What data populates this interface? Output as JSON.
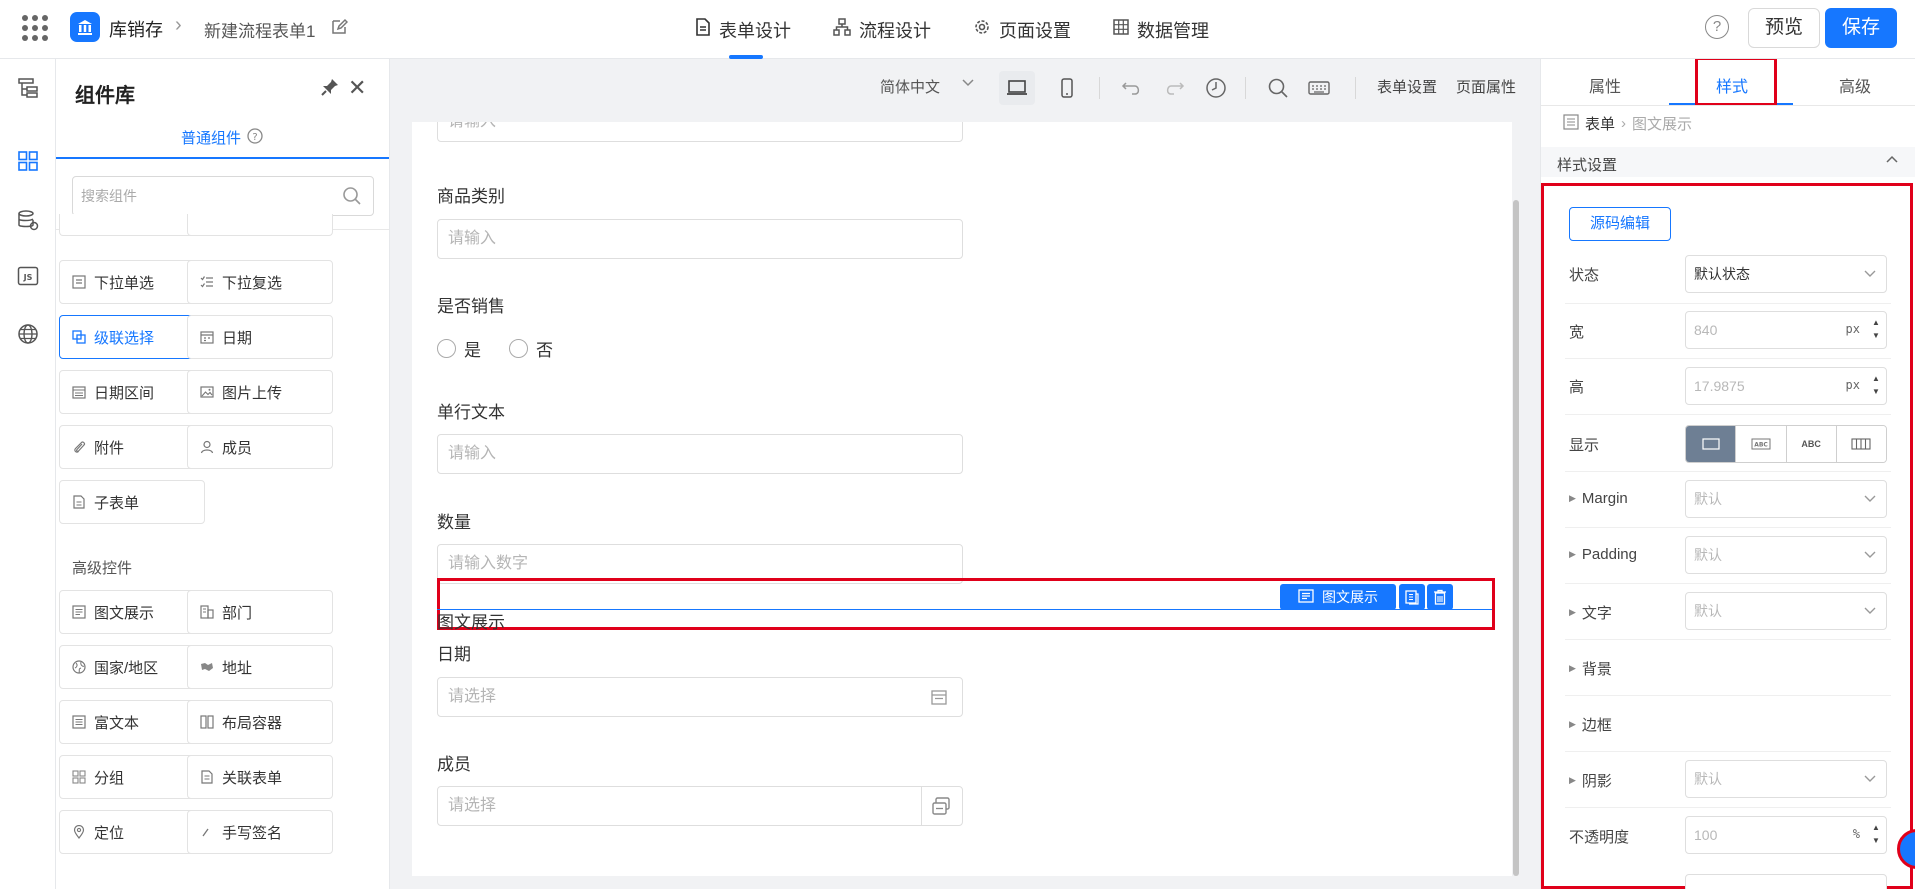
{
  "topbar": {
    "app_name": "库销存",
    "form_name": "新建流程表单1",
    "tabs": [
      {
        "label": "表单设计",
        "icon": "file-text-icon",
        "active": true
      },
      {
        "label": "流程设计",
        "icon": "flow-chart-icon",
        "active": false
      },
      {
        "label": "页面设置",
        "icon": "gear-icon",
        "active": false
      },
      {
        "label": "数据管理",
        "icon": "grid-table-icon",
        "active": false
      }
    ],
    "help": "?",
    "preview_label": "预览",
    "save_label": "保存"
  },
  "library": {
    "title": "组件库",
    "tab_label": "普通组件",
    "search_placeholder": "搜索组件",
    "basic": [
      {
        "label": "下拉单选",
        "icon": "dropdown-single-icon"
      },
      {
        "label": "下拉复选",
        "icon": "dropdown-multi-icon"
      },
      {
        "label": "级联选择",
        "icon": "cascade-icon",
        "active": true
      },
      {
        "label": "日期",
        "icon": "calendar-icon"
      },
      {
        "label": "日期区间",
        "icon": "calendar-range-icon"
      },
      {
        "label": "图片上传",
        "icon": "image-icon"
      },
      {
        "label": "附件",
        "icon": "paperclip-icon"
      },
      {
        "label": "成员",
        "icon": "user-icon"
      },
      {
        "label": "子表单",
        "icon": "subform-icon"
      }
    ],
    "advanced_title": "高级控件",
    "advanced": [
      {
        "label": "图文展示",
        "icon": "text-image-icon"
      },
      {
        "label": "部门",
        "icon": "department-icon"
      },
      {
        "label": "国家/地区",
        "icon": "globe-icon"
      },
      {
        "label": "地址",
        "icon": "map-icon"
      },
      {
        "label": "富文本",
        "icon": "rich-text-icon"
      },
      {
        "label": "布局容器",
        "icon": "layout-icon"
      },
      {
        "label": "分组",
        "icon": "group-icon"
      },
      {
        "label": "关联表单",
        "icon": "linked-form-icon"
      },
      {
        "label": "定位",
        "icon": "location-icon"
      },
      {
        "label": "手写签名",
        "icon": "signature-icon"
      }
    ]
  },
  "toolbar": {
    "language": "简体中文",
    "form_settings": "表单设置",
    "page_props": "页面属性"
  },
  "form": {
    "top_placeholder": "请输入",
    "fields": {
      "category": {
        "label": "商品类别",
        "placeholder": "请输入"
      },
      "for_sale": {
        "label": "是否销售",
        "options": [
          "是",
          "否"
        ]
      },
      "single_text": {
        "label": "单行文本",
        "placeholder": "请输入"
      },
      "quantity": {
        "label": "数量",
        "placeholder": "请输入数字"
      },
      "date": {
        "label": "日期",
        "placeholder": "请选择"
      },
      "member": {
        "label": "成员",
        "placeholder": "请选择"
      }
    },
    "selected": {
      "tag": "图文展示",
      "text": "图文展示"
    }
  },
  "panel": {
    "tabs": [
      "属性",
      "样式",
      "高级"
    ],
    "active_tab": "样式",
    "crumb_root": "表单",
    "crumb_current": "图文展示",
    "section_title": "样式设置",
    "source_edit": "源码编辑",
    "rows": {
      "state": {
        "label": "状态",
        "value": "默认状态"
      },
      "width": {
        "label": "宽",
        "value": "840",
        "unit": "px"
      },
      "height": {
        "label": "高",
        "value": "17.9875",
        "unit": "px"
      },
      "display": {
        "label": "显示",
        "options": [
          "",
          "ABC",
          "ABC",
          ""
        ]
      },
      "margin": {
        "label": "Margin",
        "value": "默认"
      },
      "padding": {
        "label": "Padding",
        "value": "默认"
      },
      "text": {
        "label": "文字",
        "value": "默认"
      },
      "background": {
        "label": "背景"
      },
      "border": {
        "label": "边框"
      },
      "shadow": {
        "label": "阴影",
        "value": "默认"
      },
      "opacity": {
        "label": "不透明度",
        "value": "100",
        "unit": "%"
      }
    }
  },
  "colors": {
    "accent": "#1677ff",
    "highlight": "#e0001a"
  }
}
